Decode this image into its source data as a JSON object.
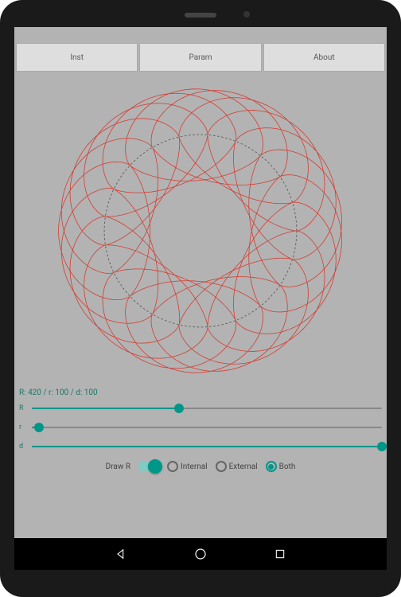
{
  "tabs": [
    {
      "label": "Inst"
    },
    {
      "label": "Param"
    },
    {
      "label": "About"
    }
  ],
  "spiro": {
    "R": 420,
    "r": 100,
    "d": 100,
    "readout": "R: 420 / r: 100 / d: 100",
    "guide_color": "#555",
    "curve_color": "#d43a2f"
  },
  "sliders": {
    "R": {
      "label": "R",
      "pct": 42
    },
    "r": {
      "label": "r",
      "pct": 2
    },
    "d": {
      "label": "d",
      "pct": 100
    }
  },
  "options": {
    "drawR_label": "Draw R",
    "drawR_on": true,
    "internal_label": "Internal",
    "external_label": "External",
    "both_label": "Both",
    "selected": "both"
  },
  "accent": "#009688"
}
